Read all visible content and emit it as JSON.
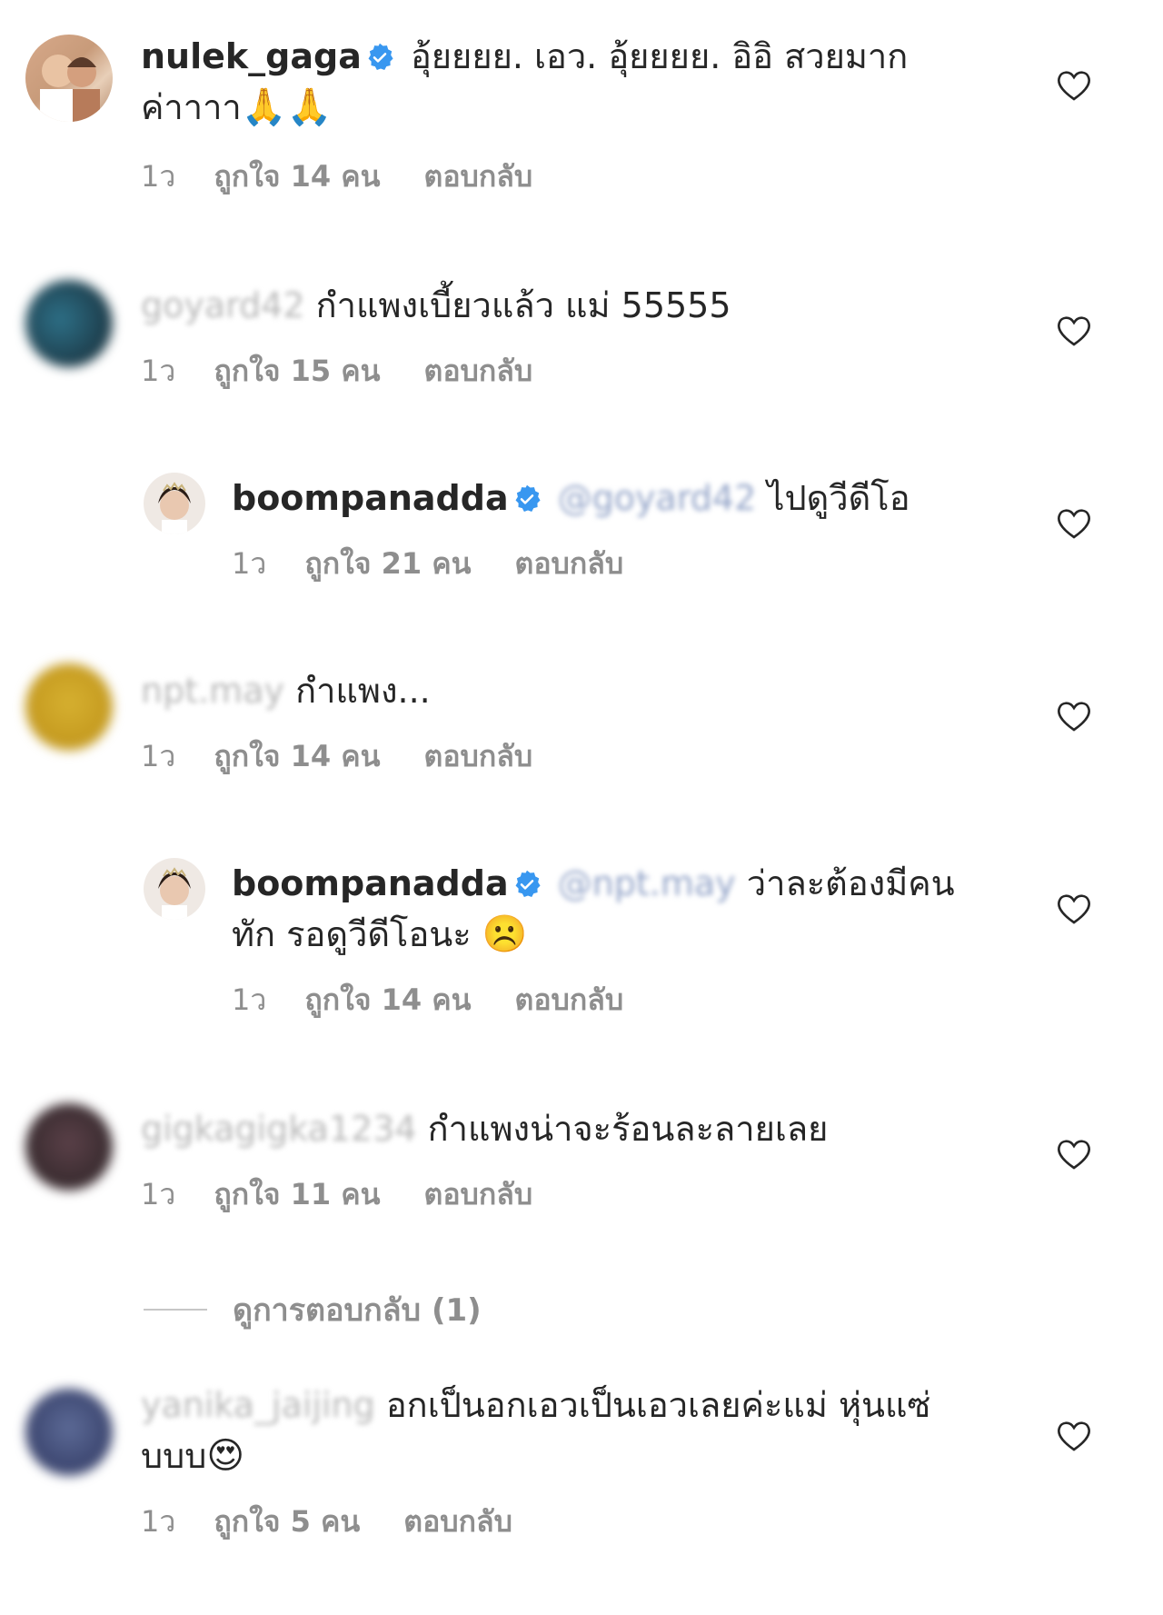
{
  "comments": [
    {
      "username": "nulek_gaga",
      "verified": true,
      "text": "อุ้ยยยย. เอว. อุ้ยยยย. อิอิ สวยมาก ค่าาาา",
      "emoji": "🙏🙏",
      "time": "1ว",
      "likes": "ถูกใจ 14 คน",
      "reply": "ตอบกลับ"
    },
    {
      "username": "goyard42",
      "verified": false,
      "text": "กำแพงเบี้ยวแล้ว แม่ 55555",
      "time": "1ว",
      "likes": "ถูกใจ 15 คน",
      "reply": "ตอบกลับ"
    },
    {
      "username": "boompanadda",
      "verified": true,
      "mention": "@goyard42",
      "text": "ไปดูวีดีโอ",
      "time": "1ว",
      "likes": "ถูกใจ 21 คน",
      "reply": "ตอบกลับ"
    },
    {
      "username": "npt.may",
      "verified": false,
      "text": "กำแพง...",
      "time": "1ว",
      "likes": "ถูกใจ 14 คน",
      "reply": "ตอบกลับ"
    },
    {
      "username": "boompanadda",
      "verified": true,
      "mention": "@npt.may",
      "text": "ว่าละต้องมีคน ทัก รอดูวีดีโอนะ",
      "emoji": "☹️",
      "time": "1ว",
      "likes": "ถูกใจ 14 คน",
      "reply": "ตอบกลับ"
    },
    {
      "username": "gigkagigka1234",
      "verified": false,
      "text": "กำแพงน่าจะร้อนละลายเลย",
      "time": "1ว",
      "likes": "ถูกใจ 11 คน",
      "reply": "ตอบกลับ"
    },
    {
      "username": "yanika_jaijing",
      "verified": false,
      "text": "อกเป็นอกเอวเป็นเอวเลยค่ะแม่ หุ่นแซ่บบบ",
      "emoji": "😍",
      "time": "1ว",
      "likes": "ถูกใจ 5 คน",
      "reply": "ตอบกลับ"
    }
  ],
  "view_replies": "ดูการตอบกลับ (1)",
  "colors": {
    "text": "#262626",
    "meta": "#8e8e8e",
    "verified": "#3897f0"
  },
  "icons": {
    "heart": "heart-outline-icon",
    "verified": "verified-badge-icon"
  }
}
